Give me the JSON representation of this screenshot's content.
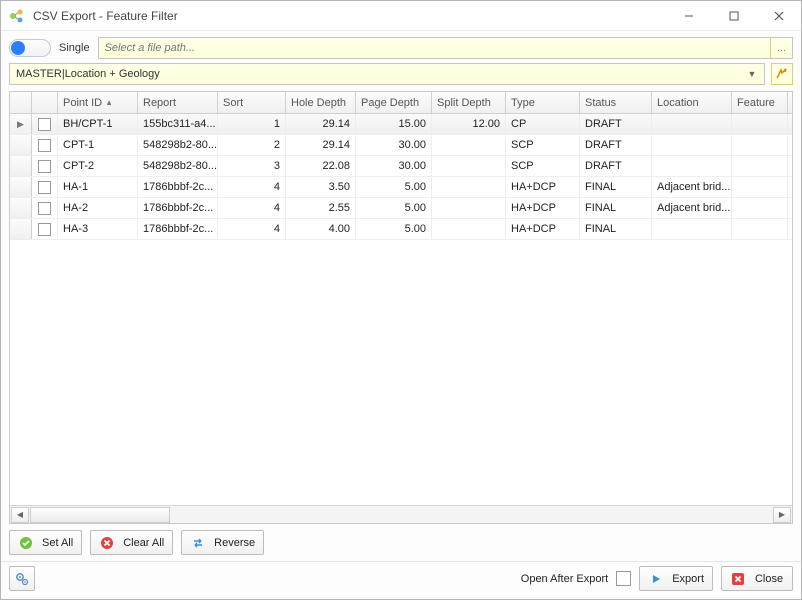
{
  "title": "CSV Export - Feature Filter",
  "toggle_label": "Single",
  "filepath_placeholder": "Select a file path...",
  "filepath_btn": "...",
  "template_combo": "MASTER|Location + Geology",
  "columns": [
    "Point ID",
    "Report",
    "Sort",
    "Hole Depth",
    "Page Depth",
    "Split Depth",
    "Type",
    "Status",
    "Location",
    "Feature"
  ],
  "sorted_col": 0,
  "rows": [
    {
      "selected": true,
      "checked": false,
      "point_id": "BH/CPT-1",
      "report": "155bc311-a4...",
      "sort": "1",
      "hole_depth": "29.14",
      "page_depth": "15.00",
      "split_depth": "12.00",
      "type": "CP",
      "status": "DRAFT",
      "location": "",
      "feature": ""
    },
    {
      "selected": false,
      "checked": false,
      "point_id": "CPT-1",
      "report": "548298b2-80...",
      "sort": "2",
      "hole_depth": "29.14",
      "page_depth": "30.00",
      "split_depth": "",
      "type": "SCP",
      "status": "DRAFT",
      "location": "",
      "feature": ""
    },
    {
      "selected": false,
      "checked": false,
      "point_id": "CPT-2",
      "report": "548298b2-80...",
      "sort": "3",
      "hole_depth": "22.08",
      "page_depth": "30.00",
      "split_depth": "",
      "type": "SCP",
      "status": "DRAFT",
      "location": "",
      "feature": ""
    },
    {
      "selected": false,
      "checked": false,
      "point_id": "HA-1",
      "report": "1786bbbf-2c...",
      "sort": "4",
      "hole_depth": "3.50",
      "page_depth": "5.00",
      "split_depth": "",
      "type": "HA+DCP",
      "status": "FINAL",
      "location": "Adjacent brid...",
      "feature": ""
    },
    {
      "selected": false,
      "checked": false,
      "point_id": "HA-2",
      "report": "1786bbbf-2c...",
      "sort": "4",
      "hole_depth": "2.55",
      "page_depth": "5.00",
      "split_depth": "",
      "type": "HA+DCP",
      "status": "FINAL",
      "location": "Adjacent brid...",
      "feature": ""
    },
    {
      "selected": false,
      "checked": false,
      "point_id": "HA-3",
      "report": "1786bbbf-2c...",
      "sort": "4",
      "hole_depth": "4.00",
      "page_depth": "5.00",
      "split_depth": "",
      "type": "HA+DCP",
      "status": "FINAL",
      "location": "",
      "feature": ""
    }
  ],
  "footer": {
    "set_all": "Set All",
    "clear_all": "Clear All",
    "reverse": "Reverse",
    "open_after_export": "Open After Export",
    "export": "Export",
    "close": "Close"
  }
}
